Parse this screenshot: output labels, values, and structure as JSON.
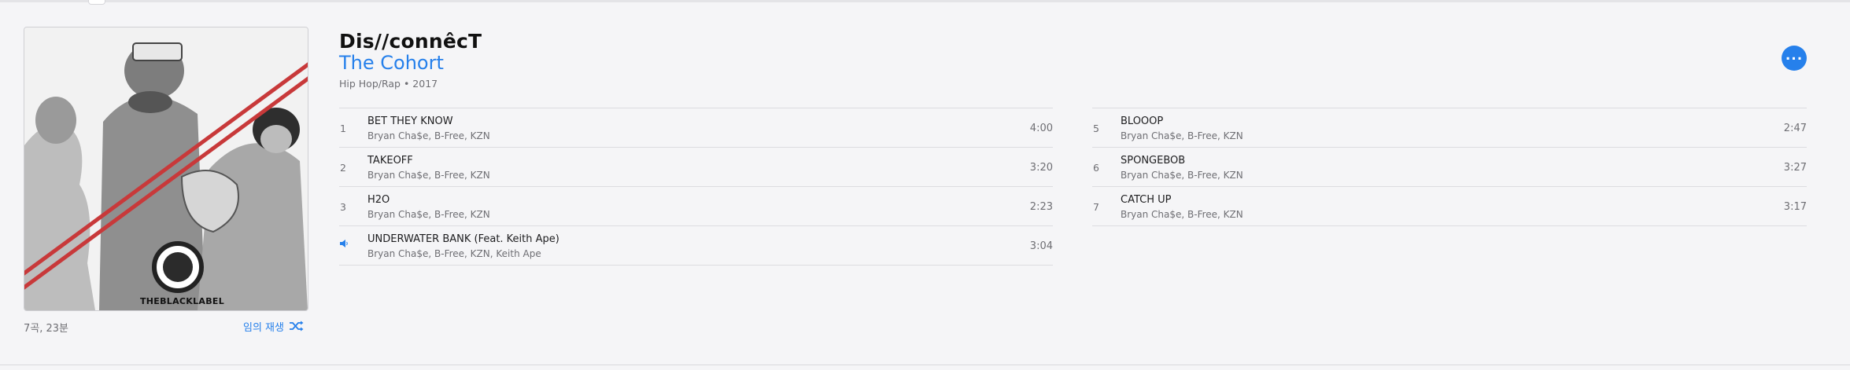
{
  "album": {
    "title": "Dis//connêcT",
    "artist": "The Cohort",
    "genre_year": "Hip Hop/Rap • 2017",
    "summary": "7곡, 23분",
    "shuffle_label": "임의 재생",
    "artwork_logo_text": "THEBLACKLABEL"
  },
  "tracks_left": [
    {
      "num": "1",
      "name": "BET THEY KNOW",
      "artists": "Bryan Cha$e, B-Free, KZN",
      "duration": "4:00"
    },
    {
      "num": "2",
      "name": "TAKEOFF",
      "artists": "Bryan Cha$e, B-Free, KZN",
      "duration": "3:20"
    },
    {
      "num": "3",
      "name": "H2O",
      "artists": "Bryan Cha$e, B-Free, KZN",
      "duration": "2:23"
    },
    {
      "num": "",
      "name": "UNDERWATER BANK (Feat. Keith Ape)",
      "artists": "Bryan Cha$e, B-Free, KZN, Keith Ape",
      "duration": "3:04",
      "playing": true
    }
  ],
  "tracks_right": [
    {
      "num": "5",
      "name": "BLOOOP",
      "artists": "Bryan Cha$e, B-Free, KZN",
      "duration": "2:47"
    },
    {
      "num": "6",
      "name": "SPONGEBOB",
      "artists": "Bryan Cha$e, B-Free, KZN",
      "duration": "3:27"
    },
    {
      "num": "7",
      "name": "CATCH UP",
      "artists": "Bryan Cha$e, B-Free, KZN",
      "duration": "3:17"
    }
  ],
  "colors": {
    "accent": "#2680eb",
    "background": "#f5f5f7",
    "artwork_stripe": "#c8393a"
  },
  "icons": {
    "more": "ellipsis-icon",
    "shuffle": "shuffle-icon",
    "now_playing": "speaker-icon"
  }
}
